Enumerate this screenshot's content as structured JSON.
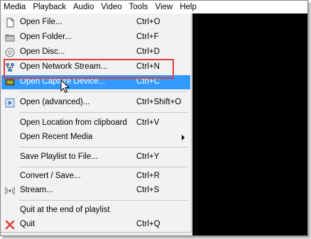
{
  "menubar": {
    "items": [
      "Media",
      "Playback",
      "Audio",
      "Video",
      "Tools",
      "View",
      "Help"
    ]
  },
  "media_menu": {
    "open_file": {
      "label": "Open File...",
      "shortcut": "Ctrl+O"
    },
    "open_folder": {
      "label": "Open Folder...",
      "shortcut": "Ctrl+F"
    },
    "open_disc": {
      "label": "Open Disc...",
      "shortcut": "Ctrl+D"
    },
    "open_network": {
      "label": "Open Network Stream...",
      "shortcut": "Ctrl+N"
    },
    "open_capture": {
      "label": "Open Capture Device...",
      "shortcut": "Ctrl+C"
    },
    "open_advanced": {
      "label": "Open (advanced)...",
      "shortcut": "Ctrl+Shift+O"
    },
    "open_location": {
      "label": "Open Location from clipboard",
      "shortcut": "Ctrl+V"
    },
    "open_recent": {
      "label": "Open Recent Media"
    },
    "save_playlist": {
      "label": "Save Playlist to File...",
      "shortcut": "Ctrl+Y"
    },
    "convert_save": {
      "label": "Convert / Save...",
      "shortcut": "Ctrl+R"
    },
    "stream": {
      "label": "Stream...",
      "shortcut": "Ctrl+S"
    },
    "quit_end": {
      "label": "Quit at the end of playlist"
    },
    "quit": {
      "label": "Quit",
      "shortcut": "Ctrl+Q"
    }
  },
  "colors": {
    "highlight": "#3399ff",
    "annotation_box": "#e03c3c",
    "video_bg": "#000000"
  },
  "icons": [
    "file-icon",
    "folder-icon",
    "disc-icon",
    "network-icon",
    "capture-device-icon",
    "advanced-open-icon",
    "stream-icon",
    "quit-icon",
    "submenu-arrow-icon",
    "mouse-cursor-icon"
  ]
}
